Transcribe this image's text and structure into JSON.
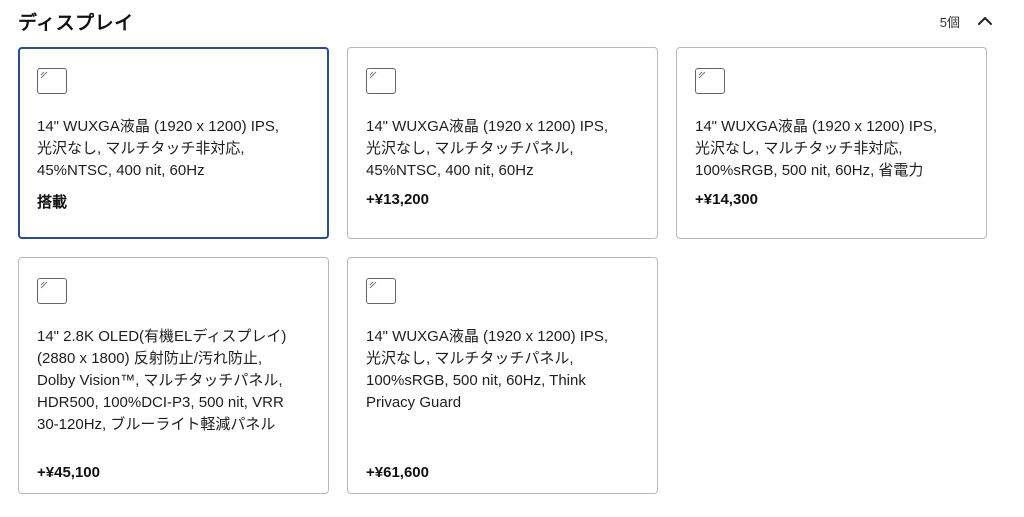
{
  "section": {
    "title": "ディスプレイ",
    "count": "5個",
    "collapse_icon": "chevron-up-icon"
  },
  "options": [
    {
      "description": "14\" WUXGA液晶 (1920 x 1200) IPS,\n光沢なし, マルチタッチ非対応,\n45%NTSC, 400 nit, 60Hz",
      "price": "搭載",
      "selected": true
    },
    {
      "description": "14\" WUXGA液晶 (1920 x 1200) IPS,\n光沢なし, マルチタッチパネル,\n45%NTSC, 400 nit, 60Hz",
      "price": "+¥13,200",
      "selected": false
    },
    {
      "description": "14\" WUXGA液晶 (1920 x 1200) IPS,\n光沢なし, マルチタッチ非対応,\n100%sRGB, 500 nit, 60Hz, 省電力",
      "price": "+¥14,300",
      "selected": false
    },
    {
      "description": "14\" 2.8K OLED(有機ELディスプレイ)\n(2880 x 1800) 反射防止/汚れ防止,\nDolby Vision™, マルチタッチパネル,\nHDR500, 100%DCI-P3, 500 nit, VRR\n30-120Hz, ブルーライト軽減パネル",
      "price": "+¥45,100",
      "selected": false
    },
    {
      "description": "14\" WUXGA液晶 (1920 x 1200) IPS,\n光沢なし, マルチタッチパネル,\n100%sRGB, 500 nit, 60Hz, Think\nPrivacy Guard",
      "price": "+¥61,600",
      "selected": false
    }
  ],
  "colors": {
    "selected_border": "#2a4f88",
    "card_border": "#b9b9b9"
  }
}
